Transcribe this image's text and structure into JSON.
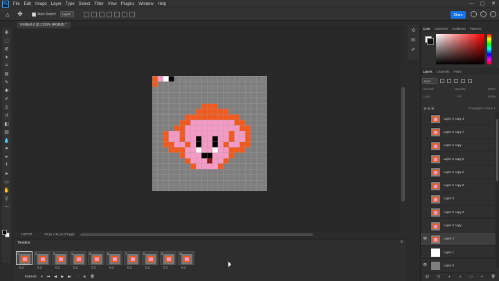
{
  "menubar": {
    "app_icon": "Ps",
    "items": [
      "File",
      "Edit",
      "Image",
      "Layer",
      "Type",
      "Select",
      "Filter",
      "View",
      "Plugins",
      "Window",
      "Help"
    ],
    "window_controls": [
      "—",
      "▢",
      "✕"
    ]
  },
  "options": {
    "auto_select_label": "Auto-Select:",
    "auto_select_value": "Layer",
    "share_label": "Share"
  },
  "document": {
    "tab_title": "Untitled-2 @ 2116% (RGB/8) *",
    "zoom_status": "2107.97",
    "size_status": "21 px x 21 px (72 ppi)"
  },
  "timeline": {
    "title": "Timeline",
    "loop": "Forever",
    "frames": [
      {
        "num": "1",
        "delay": "0.2"
      },
      {
        "num": "2",
        "delay": "0.2"
      },
      {
        "num": "3",
        "delay": "0.2"
      },
      {
        "num": "4",
        "delay": "0.2"
      },
      {
        "num": "5",
        "delay": "0.2"
      },
      {
        "num": "6",
        "delay": "0.2"
      },
      {
        "num": "7",
        "delay": "0.2"
      },
      {
        "num": "8",
        "delay": "0.2"
      },
      {
        "num": "9",
        "delay": "0.2"
      },
      {
        "num": "10",
        "delay": "0.2"
      }
    ]
  },
  "color_panel": {
    "tabs": [
      "Color",
      "Swatches",
      "Gradients",
      "Patterns"
    ]
  },
  "layers_panel": {
    "tabs": [
      "Layers",
      "Channels",
      "Paths"
    ],
    "kind": "Kind",
    "blend": "Normal",
    "opacity_label": "Opacity:",
    "opacity": "100%",
    "lock_label": "Lock:",
    "fill_label": "Fill:",
    "fill": "100%",
    "propagate": "Propagate Frame 1",
    "layers": [
      {
        "name": "Layer 2 copy 4",
        "visible": false
      },
      {
        "name": "Layer 2 copy 7",
        "visible": false
      },
      {
        "name": "Layer 2 copy",
        "visible": false
      },
      {
        "name": "Layer 2 copy 5",
        "visible": false
      },
      {
        "name": "Layer 2 copy 2",
        "visible": false
      },
      {
        "name": "Layer 2 copy 6",
        "visible": false
      },
      {
        "name": "Layer 3",
        "visible": false
      },
      {
        "name": "Layer 2 copy 3",
        "visible": false
      },
      {
        "name": "Layer 2 copy",
        "visible": false
      },
      {
        "name": "Layer 2",
        "visible": true
      },
      {
        "name": "Layer 1",
        "visible": false
      },
      {
        "name": "Layer 0",
        "visible": true
      }
    ]
  },
  "colors": {
    "accent": "#1473e6",
    "orange": "#f05a1e",
    "pink": "#f49ac4",
    "canvas_grey": "#7f7f7f"
  }
}
